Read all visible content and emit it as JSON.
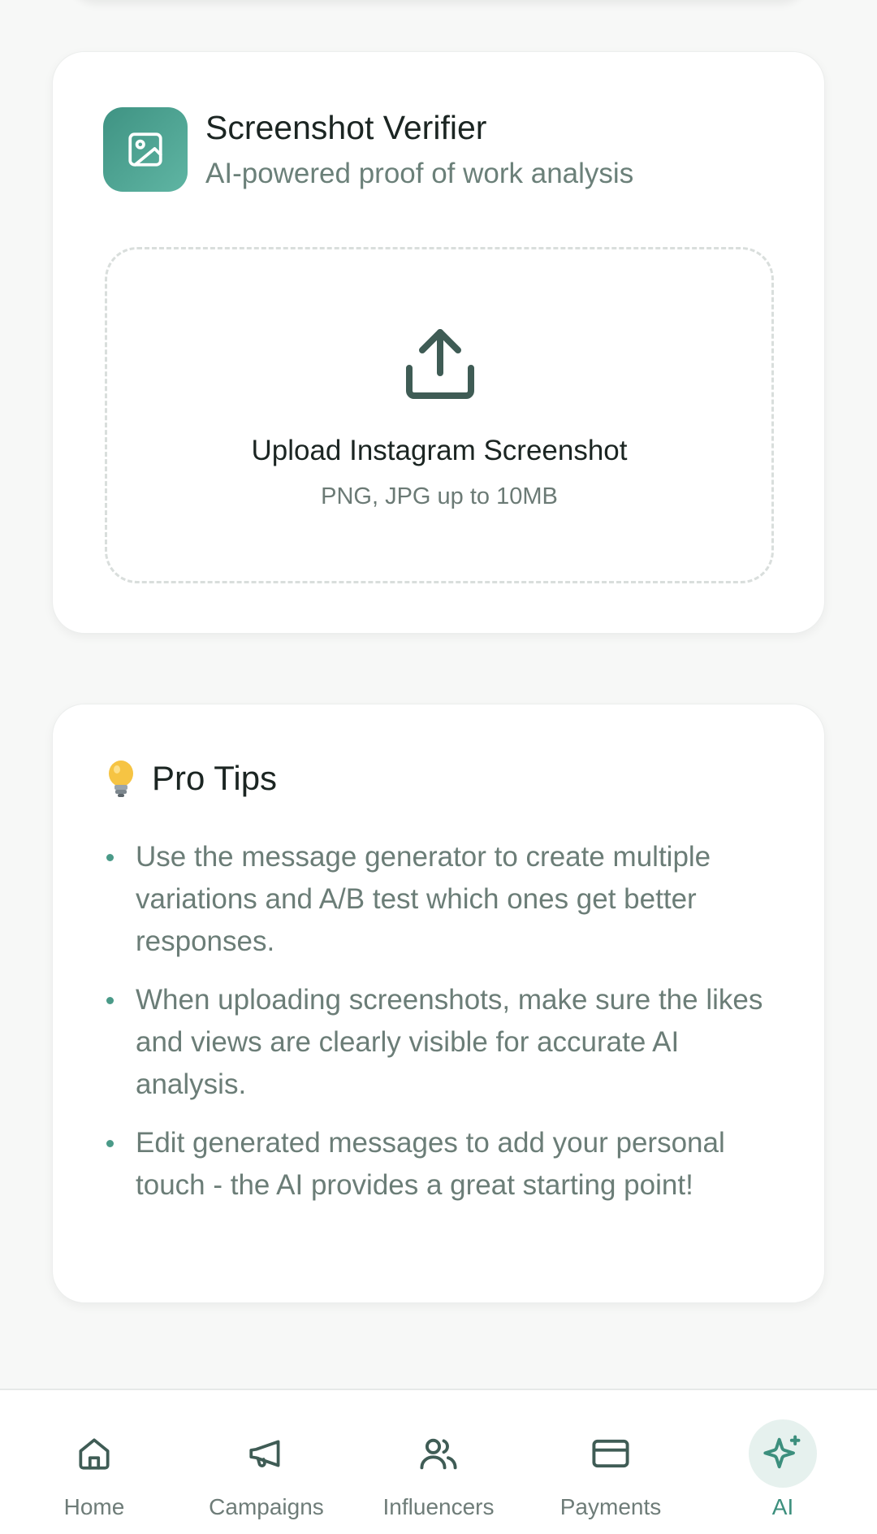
{
  "verifier": {
    "icon": "image-icon",
    "title": "Screenshot Verifier",
    "subtitle": "AI-powered proof of work analysis",
    "upload": {
      "icon": "upload-icon",
      "title": "Upload Instagram Screenshot",
      "hint": "PNG, JPG up to 10MB"
    }
  },
  "tips": {
    "icon": "lightbulb-icon",
    "title": "Pro Tips",
    "items": [
      "Use the message generator to create multiple variations and A/B test which ones get better responses.",
      "When uploading screenshots, make sure the likes and views are clearly visible for accurate AI analysis.",
      "Edit generated messages to add your personal touch - the AI provides a great starting point!"
    ]
  },
  "nav": {
    "items": [
      {
        "label": "Home",
        "icon": "home-icon",
        "active": false
      },
      {
        "label": "Campaigns",
        "icon": "megaphone-icon",
        "active": false
      },
      {
        "label": "Influencers",
        "icon": "users-icon",
        "active": false
      },
      {
        "label": "Payments",
        "icon": "card-icon",
        "active": false
      },
      {
        "label": "AI",
        "icon": "sparkles-icon",
        "active": true
      }
    ]
  },
  "colors": {
    "accent": "#3c8f7d",
    "accent_soft": "#e6f1ee",
    "text_primary": "#1b2522",
    "text_muted": "#6b7d77"
  }
}
